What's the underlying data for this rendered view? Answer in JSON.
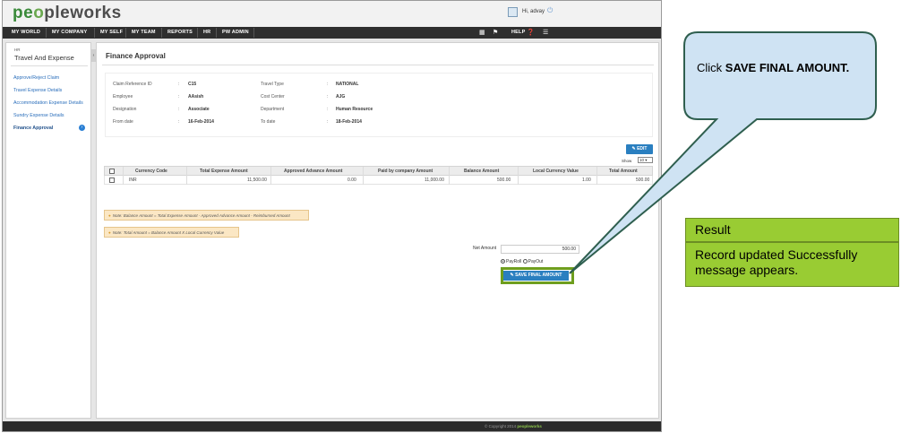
{
  "app": {
    "logo_left": "pe",
    "logo_o": "o",
    "logo_right": "pleworks",
    "user_greeting": "Hi, advay"
  },
  "nav": {
    "items": [
      "MY WORLD",
      "MY COMPANY",
      "MY SELF",
      "MY TEAM",
      "REPORTS",
      "HR",
      "PW ADMIN"
    ],
    "help": "HELP"
  },
  "sidebar": {
    "small": "HR",
    "title": "Travel And Expense",
    "items": [
      "Approve/Reject Claim",
      "Travel Expense Details",
      "Accommodation Expense Details",
      "Sundry Expense Details",
      "Finance Approval"
    ]
  },
  "main": {
    "title": "Finance Approval",
    "info": {
      "claim_ref_label": "Claim Reference ID",
      "claim_ref_value": "C15",
      "travel_type_label": "Travel Type",
      "travel_type_value": "NATIONAL",
      "employee_label": "Employee",
      "employee_value": "AAsish",
      "cost_center_label": "Cost Center",
      "cost_center_value": "AJG",
      "designation_label": "Designation",
      "designation_value": "Associate",
      "department_label": "Department",
      "department_value": "Human Resource",
      "from_date_label": "From date",
      "from_date_value": "16-Feb-2014",
      "to_date_label": "To date",
      "to_date_value": "18-Feb-2014"
    },
    "edit_label": "EDIT",
    "show_label": "Show",
    "show_value": "10",
    "table": {
      "headers": [
        "Currency Code",
        "Total Expense Amount",
        "Approved Advance Amount",
        "Paid by company Amount",
        "Balance Amount",
        "Local Currency Value",
        "Total Amount"
      ],
      "rows": [
        [
          "INR",
          "11,500.00",
          "0.00",
          "11,000.00",
          "500.00",
          "1.00",
          "500.00"
        ]
      ]
    },
    "note1": "Note: Balance Amount = Total Expense Amount - Approved Advance Amount - Reimbursed Amount",
    "note2": "Note: Total Amount = Balance Amount X Local Currency Value",
    "net_amount_label": "Net Amount",
    "net_amount_value": "500.00",
    "radio_payroll": "PayRoll",
    "radio_payout": "PayOut",
    "save_label": "SAVE FINAL AMOUNT"
  },
  "footer": {
    "copyright": "© Copyright 2014",
    "brand": "peopleworks"
  },
  "callout": {
    "prefix": "Click ",
    "emphasis": "SAVE FINAL AMOUNT."
  },
  "result": {
    "heading": "Result",
    "body": "Record updated  Successfully message appears."
  },
  "colors": {
    "accent_blue": "#2a7fc0",
    "highlight_green": "#6e9e1e",
    "result_green": "#99cc33",
    "callout_fill": "#cfe3f3",
    "callout_border": "#2f5f4f"
  }
}
